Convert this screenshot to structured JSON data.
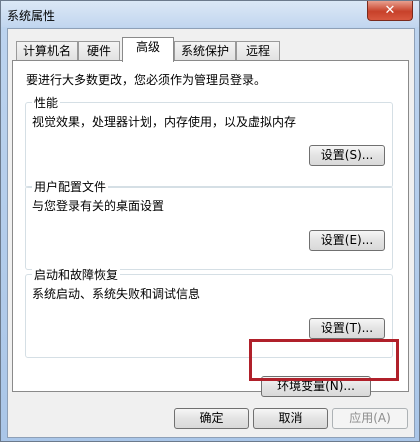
{
  "window": {
    "title": "系统属性",
    "close_symbol": "✕"
  },
  "tabs": [
    {
      "label": "计算机名",
      "active": false
    },
    {
      "label": "硬件",
      "active": false
    },
    {
      "label": "高级",
      "active": true
    },
    {
      "label": "系统保护",
      "active": false
    },
    {
      "label": "远程",
      "active": false
    }
  ],
  "panel": {
    "admin_notice": "要进行大多数更改，您必须作为管理员登录。",
    "performance": {
      "title": "性能",
      "description": "视觉效果，处理器计划，内存使用，以及虚拟内存",
      "button": "设置(S)..."
    },
    "user_profiles": {
      "title": "用户配置文件",
      "description": "与您登录有关的桌面设置",
      "button": "设置(E)..."
    },
    "startup_recovery": {
      "title": "启动和故障恢复",
      "description": "系统启动、系统失败和调试信息",
      "button": "设置(T)..."
    },
    "env_vars_button": "环境变量(N)..."
  },
  "footer": {
    "ok": "确定",
    "cancel": "取消",
    "apply": "应用(A)"
  },
  "colors": {
    "highlight_box": "#b0202a",
    "close_button": "#c7412a"
  }
}
